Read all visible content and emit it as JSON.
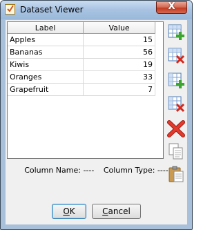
{
  "window": {
    "title": "Dataset Viewer",
    "close_glyph": "X"
  },
  "table": {
    "columns": [
      "Label",
      "Value"
    ],
    "rows": [
      {
        "label": "Apples",
        "value": "15"
      },
      {
        "label": "Bananas",
        "value": "56"
      },
      {
        "label": "Kiwis",
        "value": "19"
      },
      {
        "label": "Oranges",
        "value": "33"
      },
      {
        "label": "Grapefruit",
        "value": "7"
      }
    ]
  },
  "toolbar": [
    {
      "icon": "add-row-icon"
    },
    {
      "icon": "delete-row-icon"
    },
    {
      "icon": "add-column-icon"
    },
    {
      "icon": "delete-column-icon"
    },
    {
      "icon": "clear-icon"
    },
    {
      "icon": "copy-icon"
    },
    {
      "icon": "paste-icon"
    }
  ],
  "status": {
    "column_name": "Column Name: ----",
    "column_type": "Column Type: ----"
  },
  "buttons": {
    "ok_mnemonic": "O",
    "ok_rest": "K",
    "cancel_mnemonic": "C",
    "cancel_rest": "ancel"
  },
  "colors": {
    "accent_green": "#3aa62e",
    "delete_red": "#d2281e",
    "title_bar": "#a9c0da"
  }
}
